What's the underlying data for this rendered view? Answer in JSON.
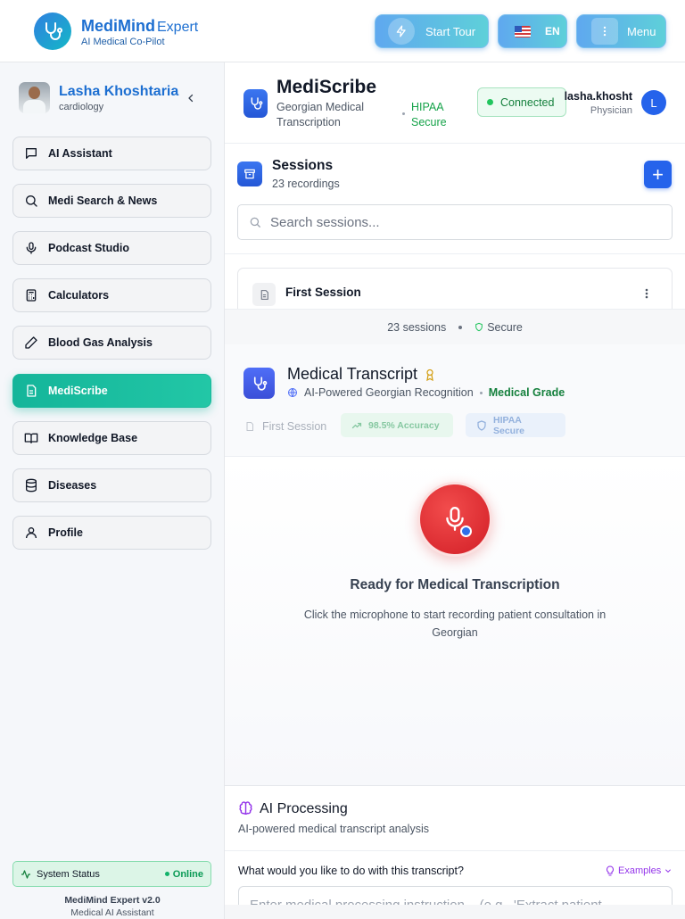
{
  "header": {
    "brand_name": "MediMind",
    "brand_suffix": "Expert",
    "brand_tagline": "AI Medical Co-Pilot",
    "tour_label": "Start Tour",
    "lang_label": "EN",
    "menu_label": "Menu"
  },
  "sidebar": {
    "user_name": "Lasha Khoshtaria",
    "user_specialty": "cardiology",
    "items": [
      {
        "label": "AI Assistant",
        "icon": "message-square-icon"
      },
      {
        "label": "Medi Search & News",
        "icon": "search-icon"
      },
      {
        "label": "Podcast Studio",
        "icon": "mic-icon"
      },
      {
        "label": "Calculators",
        "icon": "calculator-icon"
      },
      {
        "label": "Blood Gas Analysis",
        "icon": "pen-icon"
      },
      {
        "label": "MediScribe",
        "icon": "file-text-icon",
        "active": true
      },
      {
        "label": "Knowledge Base",
        "icon": "book-icon"
      },
      {
        "label": "Diseases",
        "icon": "database-icon"
      },
      {
        "label": "Profile",
        "icon": "user-icon"
      }
    ],
    "status_label": "System Status",
    "status_value": "Online",
    "version": "MediMind Expert v2.0",
    "version_sub": "Medical AI Assistant"
  },
  "main": {
    "title": "MediScribe",
    "subtitle_line1": "Georgian Medical",
    "subtitle_line2": "Transcription",
    "hipaa_line1": "HIPAA",
    "hipaa_line2": "Secure",
    "connection_status": "Connected",
    "account_name": "lasha.khosht",
    "account_role": "Physician",
    "account_initial": "L"
  },
  "sessions": {
    "title": "Sessions",
    "count_label": "23 recordings",
    "add_label": "+",
    "search_placeholder": "Search sessions...",
    "items": [
      {
        "name": "First Session"
      }
    ],
    "footer_count": "23 sessions",
    "footer_secure": "Secure"
  },
  "transcript": {
    "title": "Medical Transcript",
    "subtitle": "AI-Powered Georgian Recognition",
    "grade": "Medical Grade",
    "session_chip": "First Session",
    "accuracy_chip": "98.5% Accuracy",
    "secure_chip": "HIPAA Secure"
  },
  "recorder": {
    "title": "Ready for Medical Transcription",
    "description": "Click the microphone to start recording patient consultation in Georgian"
  },
  "ai_processing": {
    "title": "AI Processing",
    "subtitle": "AI-powered medical transcript analysis",
    "question": "What would you like to do with this transcript?",
    "examples_label": "Examples",
    "input_placeholder": "Enter medical processing instruction... (e.g., 'Extract patient"
  },
  "colors": {
    "primary": "#2563eb",
    "active_nav": "#14b59a",
    "success": "#16a34a",
    "record": "#dc2626",
    "accent_purple": "#9333ea"
  }
}
